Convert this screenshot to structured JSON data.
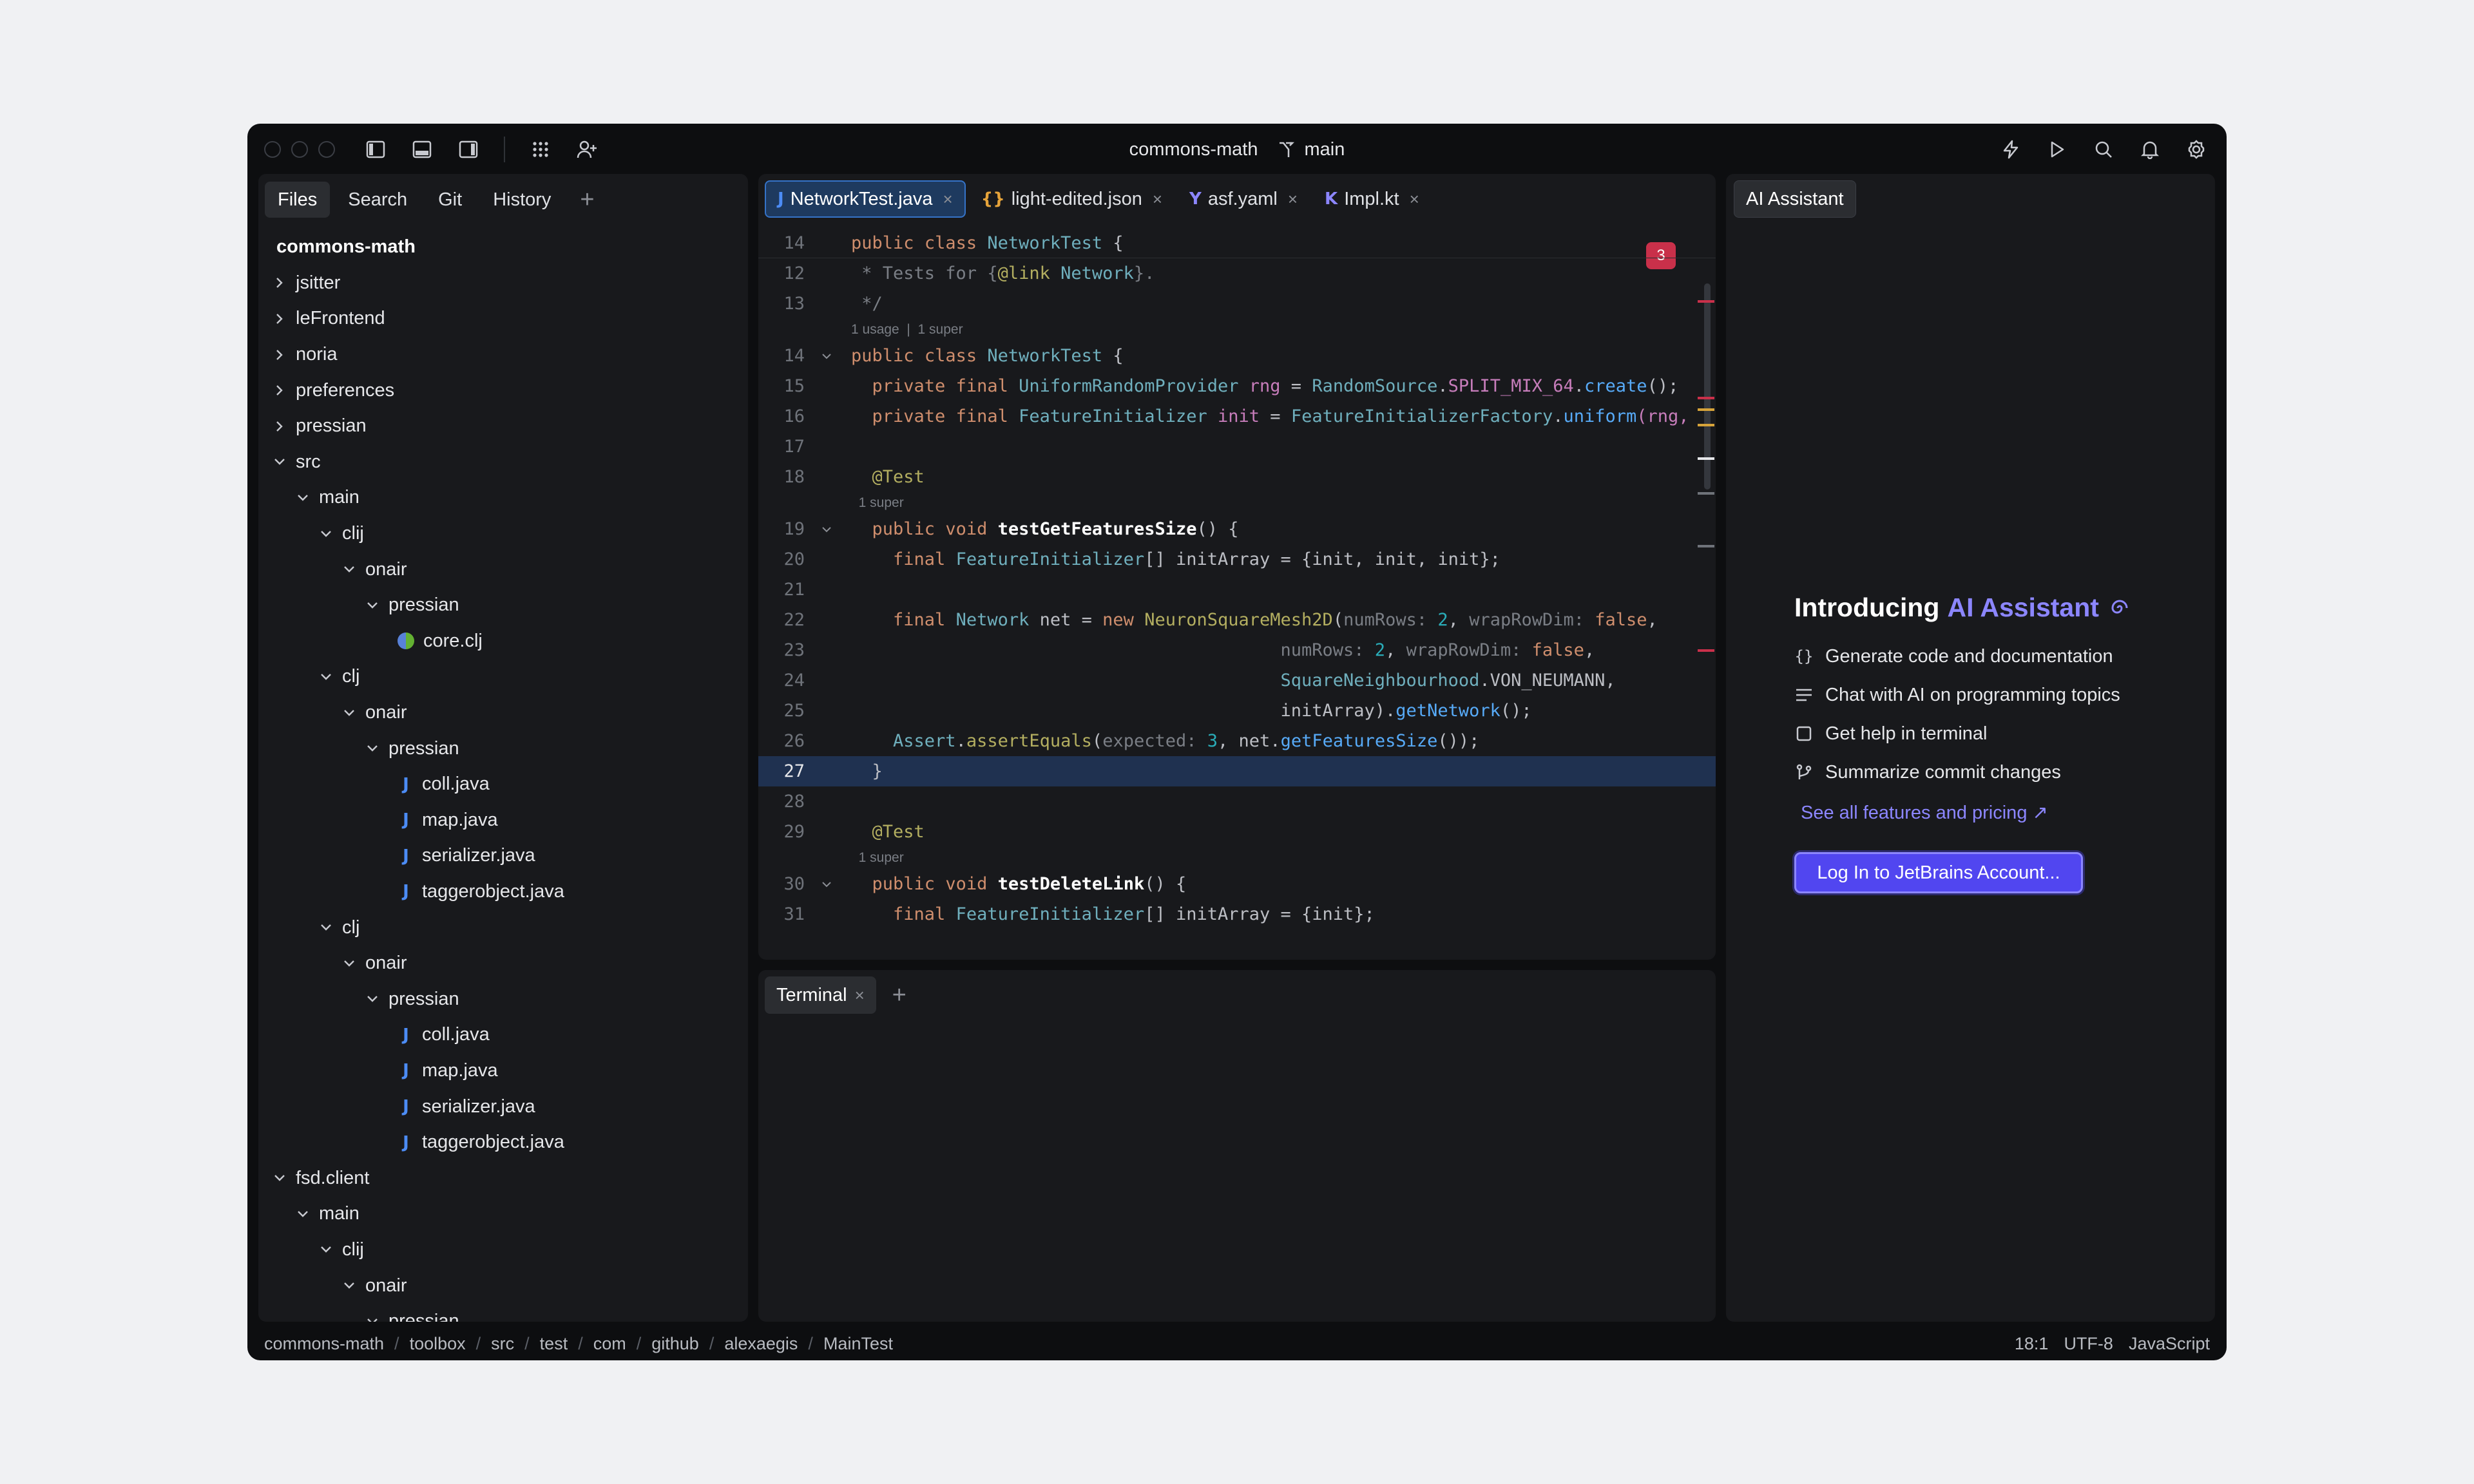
{
  "titlebar": {
    "project": "commons-math",
    "branch": "main"
  },
  "files": {
    "tabs": [
      "Files",
      "Search",
      "Git",
      "History"
    ],
    "tree": [
      {
        "label": "commons-math",
        "depth": 0,
        "type": "root"
      },
      {
        "label": "jsitter",
        "depth": 0,
        "type": "closed"
      },
      {
        "label": "leFrontend",
        "depth": 0,
        "type": "closed"
      },
      {
        "label": "noria",
        "depth": 0,
        "type": "closed"
      },
      {
        "label": "preferences",
        "depth": 0,
        "type": "closed"
      },
      {
        "label": "pressian",
        "depth": 0,
        "type": "closed"
      },
      {
        "label": "src",
        "depth": 0,
        "type": "open"
      },
      {
        "label": "main",
        "depth": 1,
        "type": "open"
      },
      {
        "label": "clij",
        "depth": 2,
        "type": "open"
      },
      {
        "label": "onair",
        "depth": 3,
        "type": "open"
      },
      {
        "label": "pressian",
        "depth": 4,
        "type": "open"
      },
      {
        "label": "core.clj",
        "depth": 5,
        "type": "clj"
      },
      {
        "label": "clj",
        "depth": 2,
        "type": "open"
      },
      {
        "label": "onair",
        "depth": 3,
        "type": "open"
      },
      {
        "label": "pressian",
        "depth": 4,
        "type": "open"
      },
      {
        "label": "coll.java",
        "depth": 5,
        "type": "java"
      },
      {
        "label": "map.java",
        "depth": 5,
        "type": "java"
      },
      {
        "label": "serializer.java",
        "depth": 5,
        "type": "java"
      },
      {
        "label": "taggerobject.java",
        "depth": 5,
        "type": "java"
      },
      {
        "label": "clj",
        "depth": 2,
        "type": "open"
      },
      {
        "label": "onair",
        "depth": 3,
        "type": "open"
      },
      {
        "label": "pressian",
        "depth": 4,
        "type": "open"
      },
      {
        "label": "coll.java",
        "depth": 5,
        "type": "java"
      },
      {
        "label": "map.java",
        "depth": 5,
        "type": "java"
      },
      {
        "label": "serializer.java",
        "depth": 5,
        "type": "java"
      },
      {
        "label": "taggerobject.java",
        "depth": 5,
        "type": "java"
      },
      {
        "label": "fsd.client",
        "depth": 0,
        "type": "open"
      },
      {
        "label": "main",
        "depth": 1,
        "type": "open"
      },
      {
        "label": "clij",
        "depth": 2,
        "type": "open"
      },
      {
        "label": "onair",
        "depth": 3,
        "type": "open"
      },
      {
        "label": "pressian",
        "depth": 4,
        "type": "open"
      }
    ]
  },
  "editor": {
    "tabs": [
      {
        "label": "NetworkTest.java",
        "icon": "J",
        "color": "#4c8cf5",
        "active": true
      },
      {
        "label": "light-edited.json",
        "icon": "{}",
        "color": "#e5a33a",
        "active": false
      },
      {
        "label": "asf.yaml",
        "icon": "Y",
        "color": "#8c86ff",
        "active": false
      },
      {
        "label": "Impl.kt",
        "icon": "K",
        "color": "#8c86ff",
        "active": false
      }
    ],
    "problems_count": "3",
    "hints": {
      "usage": "1 usage",
      "super": "1 super"
    },
    "lines": {
      "l14s": "14",
      "l12": "12",
      "l13": "13",
      "l14": "14",
      "l15": "15",
      "l16": "16",
      "l17": "17",
      "l18": "18",
      "l19": "19",
      "l20": "20",
      "l21": "21",
      "l22": "22",
      "l23": "23",
      "l24": "24",
      "l25": "25",
      "l26": "26",
      "l27": "27",
      "l28": "28",
      "l29": "29",
      "l30": "30",
      "l31": "31"
    },
    "code": {
      "public": "public",
      "class": "class",
      "private": "private",
      "final": "final",
      "void": "void",
      "new": "new",
      "false": "false",
      "NetworkTest": "NetworkTest",
      "brace_open": " {",
      "brace_close": "}",
      "doc1": " * Tests for {",
      "doc_link": "@link",
      "doc_net": " Network",
      "doc1_end": "}.",
      "doc2": " */",
      "UniformRandomProvider": "UniformRandomProvider",
      "rng": "rng",
      "eq": " = ",
      "RandomSource": "RandomSource",
      "dot": ".",
      "SPLIT_MIX_64": "SPLIT_MIX_64",
      "create": "create",
      "call_end": "();",
      "FeatureInitializer": "FeatureInitializer",
      "init": "init",
      "FeatureInitializerFactory": "FeatureInitializerFactory",
      "uniform": "uniform",
      "uniform_args": "(rng,",
      "Test": "@Test",
      "testGetFeaturesSize": "testGetFeaturesSize",
      "paren_brace": "() {",
      "arr": "[] initArray = {init, init, init};",
      "Network": "Network",
      "net": " net = ",
      "NeuronSquareMesh2D": "NeuronSquareMesh2D",
      "numRows": "numRows: ",
      "wrapRowDim": "wrapRowDim: ",
      "two": "2",
      "comma": ", ",
      "SquareNeighbourhood": "SquareNeighbourhood",
      "VON_NEUMANN": "VON_NEUMANN,",
      "initArray": "initArray).",
      "getNetwork": "getNetwork",
      "Assert": "Assert",
      "assertEquals": "assertEquals",
      "expected": "expected: ",
      "three": "3",
      "netdot": ", net.",
      "getFeaturesSize": "getFeaturesSize",
      "end2": "());",
      "testDeleteLink": "testDeleteLink",
      "arr2": "[] initArray = {init};"
    }
  },
  "terminal": {
    "tab": "Terminal"
  },
  "ai": {
    "tab": "AI Assistant",
    "title_prefix": "Introducing ",
    "title_accent": "AI Assistant",
    "features": [
      {
        "icon": "braces-icon",
        "label": "Generate code and documentation"
      },
      {
        "icon": "lines-icon",
        "label": "Chat with AI on programming topics"
      },
      {
        "icon": "terminal-icon",
        "label": "Get help in terminal"
      },
      {
        "icon": "commit-icon",
        "label": "Summarize commit changes"
      }
    ],
    "link": "See all features and pricing ↗",
    "button": "Log In to JetBrains Account..."
  },
  "status": {
    "breadcrumbs": [
      "commons-math",
      "toolbox",
      "src",
      "test",
      "com",
      "github",
      "alexaegis",
      "MainTest"
    ],
    "position": "18:1",
    "encoding": "UTF-8",
    "language": "JavaScript"
  }
}
